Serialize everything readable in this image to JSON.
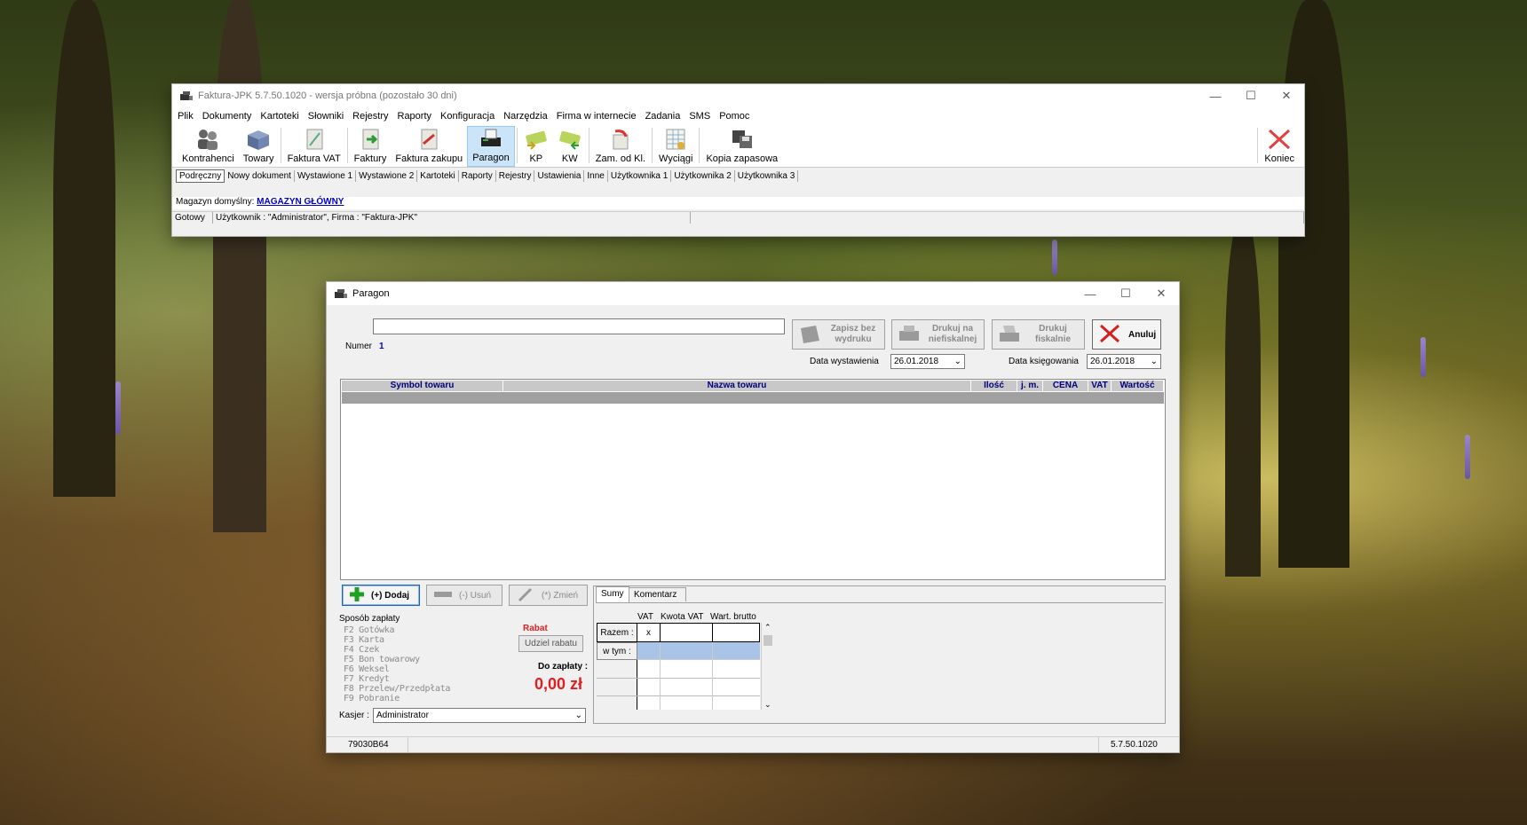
{
  "main_window": {
    "title": "Faktura-JPK 5.7.50.1020 - wersja próbna (pozostało 30 dni)",
    "menu": [
      "Plik",
      "Dokumenty",
      "Kartoteki",
      "Słowniki",
      "Rejestry",
      "Raporty",
      "Konfiguracja",
      "Narzędzia",
      "Firma w internecie",
      "Zadania",
      "SMS",
      "Pomoc"
    ],
    "toolbar": {
      "kontrahenci": "Kontrahenci",
      "towary": "Towary",
      "faktura_vat": "Faktura VAT",
      "faktury": "Faktury",
      "faktura_zakupu": "Faktura zakupu",
      "paragon": "Paragon",
      "kp": "KP",
      "kw": "KW",
      "zam_od_kl": "Zam. od Kl.",
      "wyciagi": "Wyciągi",
      "kopia_zapasowa": "Kopia zapasowa",
      "koniec": "Koniec"
    },
    "tabs": [
      "Podręczny",
      "Nowy dokument",
      "Wystawione 1",
      "Wystawione 2",
      "Kartoteki",
      "Raporty",
      "Rejestry",
      "Ustawienia",
      "Inne",
      "Użytkownika 1",
      "Użytkownika 2",
      "Użytkownika 3"
    ],
    "magazyn_label": "Magazyn domyślny:",
    "magazyn_value": "MAGAZYN GŁÓWNY",
    "status": {
      "state": "Gotowy",
      "user": "Użytkownik : \"Administrator\", Firma : \"Faktura-JPK\""
    }
  },
  "paragon": {
    "title": "Paragon",
    "number_input_value": "",
    "numer_label": "Numer",
    "numer_value": "1",
    "buttons": {
      "zapisz": "Zapisz bez wydruku",
      "drukuj_niefiskalnie": "Drukuj na niefiskalnej",
      "drukuj_fiskalnie": "Drukuj fiskalnie",
      "anuluj": "Anuluj"
    },
    "data_wystawienia_label": "Data wystawienia",
    "data_wystawienia": "26.01.2018",
    "data_ksiegowania_label": "Data księgowania",
    "data_ksiegowania": "26.01.2018",
    "grid_columns": [
      "Symbol towaru",
      "Nazwa towaru",
      "Ilość",
      "j. m.",
      "CENA",
      "VAT",
      "Wartość"
    ],
    "dodaj": "(+) Dodaj",
    "usun": "(-) Usuń",
    "zmien": "(*) Zmień",
    "sposob_zaplaty_label": "Sposób zapłaty",
    "payment_methods": [
      "F2 Gotówka",
      "F3 Karta",
      "F4 Czek",
      "F5 Bon towarowy",
      "F6 Weksel",
      "F7 Kredyt",
      "F8 Przelew/Przedpłata",
      "F9 Pobranie"
    ],
    "rabat_label": "Rabat",
    "udziel_rabatu": "Udziel rabatu",
    "do_zaplaty_label": "Do zapłaty :",
    "do_zaplaty_value": "0,00 zł",
    "kasjer_label": "Kasjer :",
    "kasjer_value": "Administrator",
    "tab_sumy": "Sumy",
    "tab_komentarz": "Komentarz",
    "sums_headers": [
      "VAT",
      "Kwota VAT",
      "Wart. brutto"
    ],
    "razem_label": "Razem :",
    "razem_vat": "x",
    "w_tym_label": "w tym :",
    "status_left": "79030B64",
    "status_right": "5.7.50.1020"
  },
  "colors": {
    "accent_red": "#e02020",
    "link_blue": "#0000cc",
    "grid_header_text": "#00007f",
    "selection_blue": "#a9c4e6"
  }
}
